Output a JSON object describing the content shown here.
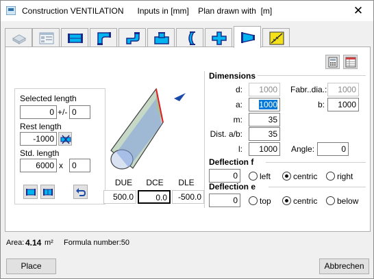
{
  "window": {
    "title": "Construction VENTILATION      Inputs in [mm]    Plan drawn with  [m]",
    "close_label": "✕"
  },
  "tabs": [
    {
      "icon": "flat-box-icon"
    },
    {
      "icon": "form-list-icon"
    },
    {
      "icon": "straight-duct-icon"
    },
    {
      "icon": "bend-duct-icon"
    },
    {
      "icon": "offset-duct-icon"
    },
    {
      "icon": "branch-duct-icon"
    },
    {
      "icon": "curved-duct-icon"
    },
    {
      "icon": "cross-duct-icon"
    },
    {
      "icon": "reducer-duct-icon"
    },
    {
      "icon": "yellow-ruler-icon"
    }
  ],
  "length_group": {
    "selected_label": "Selected length",
    "selected_value": "0",
    "plusminus_label": "+/-",
    "plusminus_value": "0",
    "rest_label": "Rest length",
    "rest_value": "-1000",
    "std_label": "Std. length",
    "std_value": "6000",
    "x_label": "x",
    "x_value": "0"
  },
  "offsets": {
    "due_label": "DUE",
    "dce_label": "DCE",
    "dle_label": "DLE",
    "due_value": "500.0",
    "dce_value": "0.0",
    "dle_value": "-500.0"
  },
  "dimensions": {
    "heading": "Dimensions",
    "d_label": "d:",
    "d_value": "1000",
    "fabr_label": "Fabr..dia.:",
    "fabr_value": "1000",
    "a_label": "a:",
    "a_value": "1000",
    "b_label": "b:",
    "b_value": "1000",
    "m_label": "m:",
    "m_value": "35",
    "dist_label": "Dist. a/b:",
    "dist_value": "35",
    "l_label": "l:",
    "l_value": "1000",
    "angle_label": "Angle:",
    "angle_value": "0"
  },
  "deflection_f": {
    "heading": "Deflection f",
    "value": "0",
    "options": [
      "left",
      "centric",
      "right"
    ],
    "selected": "centric"
  },
  "deflection_e": {
    "heading": "Deflection e",
    "value": "0",
    "options": [
      "top",
      "centric",
      "below"
    ],
    "selected": "centric"
  },
  "status": {
    "area_label": "Area:",
    "area_value": "4.14",
    "area_unit": "m²",
    "formula_label": "Formula number:50"
  },
  "buttons": {
    "place_label": "Place",
    "cancel_label": "Abbrechen"
  },
  "colors": {
    "accent": "#0078d7",
    "icon_blue": "#00b4f0",
    "icon_navy": "#1a2a8a",
    "preview_fill": "#c6d8c6",
    "preview_inner": "#7fa0e0",
    "preview_edge": "#e02020"
  }
}
